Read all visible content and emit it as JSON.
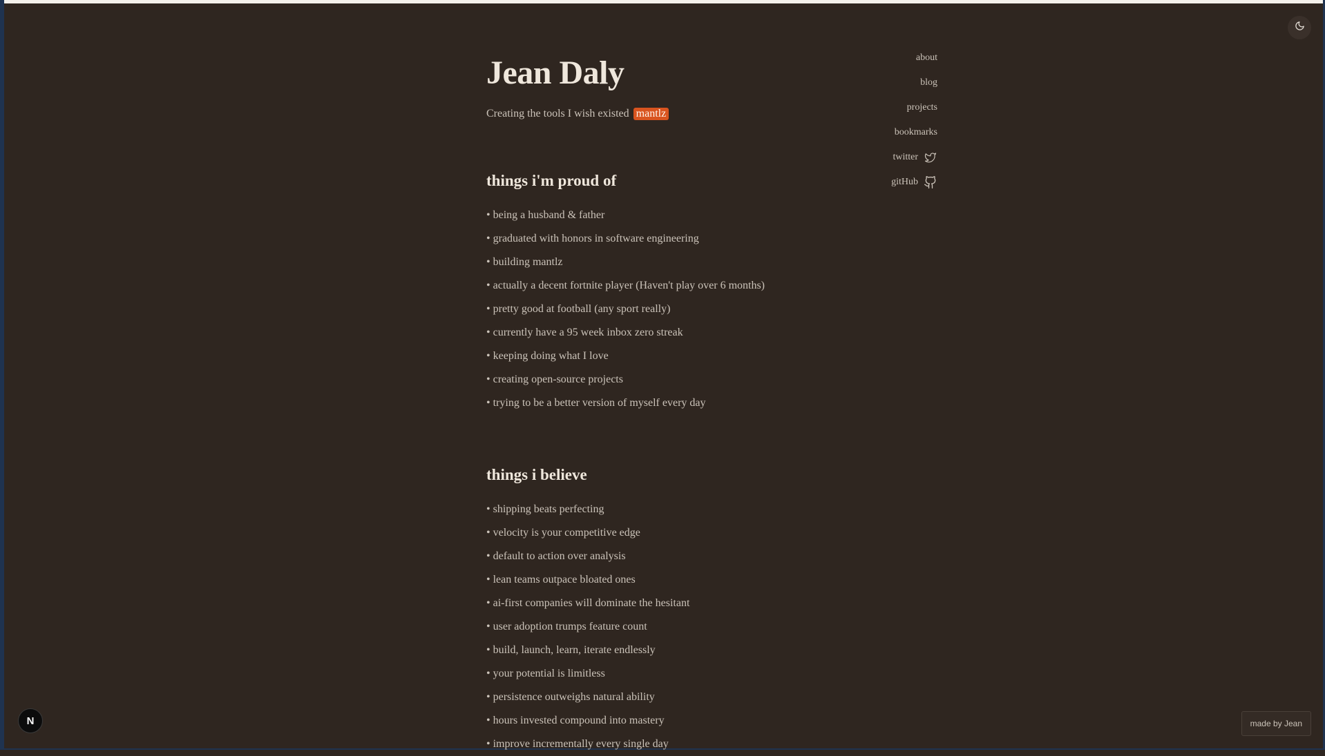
{
  "header": {
    "title": "Jean Daly",
    "tagline": "Creating the tools I wish existed",
    "badge": "mantlz"
  },
  "sections": [
    {
      "title": "things i'm proud of",
      "items": [
        "being a husband & father",
        "graduated with honors in software engineering",
        "building mantlz",
        "actually a decent fortnite player (Haven't play over 6 months)",
        "pretty good at football (any sport really)",
        "currently have a 95 week inbox zero streak",
        "keeping doing what I love",
        "creating open-source projects",
        "trying to be a better version of myself every day"
      ]
    },
    {
      "title": "things i believe",
      "items": [
        "shipping beats perfecting",
        "velocity is your competitive edge",
        "default to action over analysis",
        "lean teams outpace bloated ones",
        "ai-first companies will dominate the hesitant",
        "user adoption trumps feature count",
        "build, launch, learn, iterate endlessly",
        "your potential is limitless",
        "persistence outweighs natural ability",
        "hours invested compound into mastery",
        "improve incrementally every single day"
      ]
    }
  ],
  "nav": [
    {
      "label": "about",
      "icon": ""
    },
    {
      "label": "blog",
      "icon": ""
    },
    {
      "label": "projects",
      "icon": ""
    },
    {
      "label": "bookmarks",
      "icon": ""
    },
    {
      "label": "twitter",
      "icon": "twitter-icon"
    },
    {
      "label": "gitHub",
      "icon": "github-icon"
    }
  ],
  "footer": {
    "made_by": "made by Jean",
    "framework_badge": "N"
  },
  "theme": {
    "toggle_icon": "moon-icon",
    "background": "#2f2620",
    "accent": "#d9541f"
  }
}
